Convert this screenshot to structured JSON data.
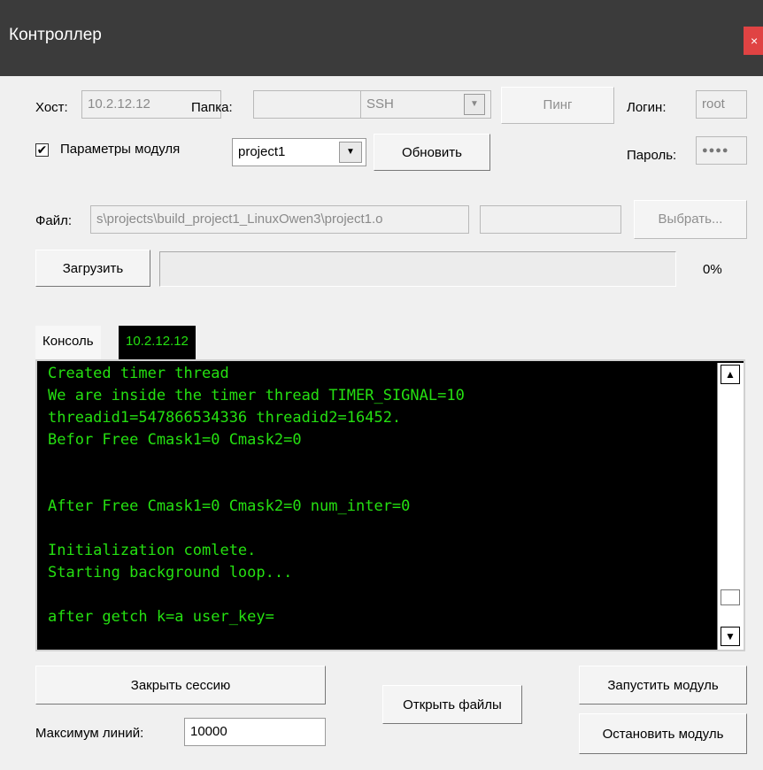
{
  "window": {
    "title": "Контроллер",
    "close": "×"
  },
  "row1": {
    "host_label": "Хост:",
    "host_value": "10.2.12.12",
    "folder_label": "Папка:",
    "folder_value": "",
    "protocol_value": "SSH",
    "ping_label": "Пинг",
    "login_label": "Логин:",
    "login_value": "root"
  },
  "row2": {
    "module_params_checked": true,
    "module_params_label": "Параметры модуля",
    "project_value": "project1",
    "refresh_label": "Обновить",
    "password_label": "Пароль:",
    "password_mask": "●●●●"
  },
  "row3": {
    "file_label": "Файл:",
    "file_value": "s\\projects\\build_project1_LinuxOwen3\\project1.o",
    "file_extra_value": "",
    "choose_label": "Выбрать..."
  },
  "row4": {
    "upload_label": "Загрузить",
    "progress": 0,
    "progress_text": "0%"
  },
  "tabs": [
    {
      "label": "Консоль",
      "active": false
    },
    {
      "label": "10.2.12.12",
      "active": true
    }
  ],
  "console": {
    "lines": [
      "Created timer thread",
      "We are inside the timer thread TIMER_SIGNAL=10",
      "threadid1=547866534336 threadid2=16452.",
      "Befor Free Cmask1=0 Cmask2=0",
      "",
      "",
      "After Free Cmask1=0 Cmask2=0 num_inter=0",
      "",
      "Initialization comlete.",
      "Starting background loop...",
      "",
      "after getch k=a user_key="
    ],
    "colors": {
      "background": "#000000",
      "text": "#25e011"
    }
  },
  "bottom": {
    "close_session_label": "Закрыть сессию",
    "open_files_label": "Открыть файлы",
    "start_module_label": "Запустить модуль",
    "stop_module_label": "Остановить модуль",
    "max_lines_label": "Максимум линий:",
    "max_lines_value": "10000"
  }
}
